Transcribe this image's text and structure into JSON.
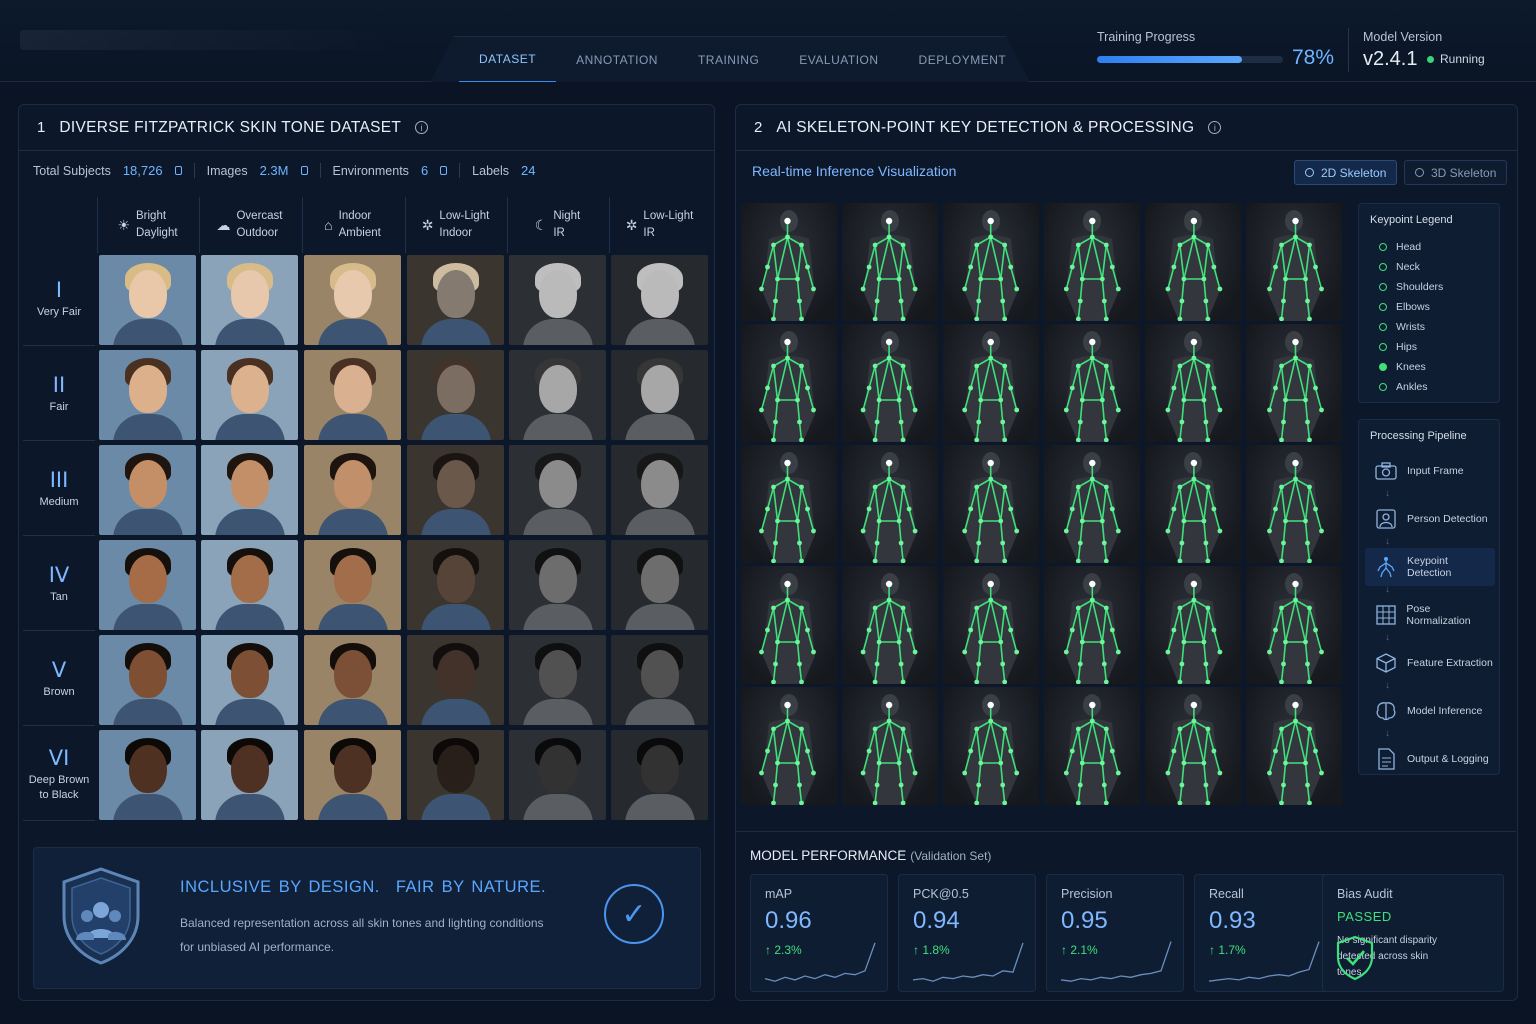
{
  "nav": {
    "tabs": [
      {
        "label": "DATASET",
        "active": true
      },
      {
        "label": "ANNOTATION",
        "active": false
      },
      {
        "label": "TRAINING",
        "active": false
      },
      {
        "label": "EVALUATION",
        "active": false
      },
      {
        "label": "DEPLOYMENT",
        "active": false
      }
    ]
  },
  "training": {
    "label": "Training Progress",
    "percent_text": "78%",
    "progress": 0.78
  },
  "model": {
    "label": "Model Version",
    "version": "v2.4.1",
    "status": "Running",
    "status_color": "#37d67a"
  },
  "dataset_panel": {
    "number": "1",
    "title": "DIVERSE FITZPATRICK SKIN TONE DATASET",
    "stats": [
      {
        "label": "Total Subjects",
        "value": "18,726"
      },
      {
        "label": "Images",
        "value": "2.3M"
      },
      {
        "label": "Environments",
        "value": "6"
      },
      {
        "label": "Labels",
        "value": "24"
      }
    ],
    "columns": [
      {
        "icon": "sun-icon",
        "glyph": "☀",
        "line1": "Bright",
        "line2": "Daylight"
      },
      {
        "icon": "cloud-icon",
        "glyph": "☁",
        "line1": "Overcast",
        "line2": "Outdoor"
      },
      {
        "icon": "house-icon",
        "glyph": "⌂",
        "line1": "Indoor",
        "line2": "Ambient"
      },
      {
        "icon": "lightbulb-icon",
        "glyph": "✲",
        "line1": "Low-Light",
        "line2": "Indoor"
      },
      {
        "icon": "moon-icon",
        "glyph": "☾",
        "line1": "Night",
        "line2": "IR"
      },
      {
        "icon": "ir-light-icon",
        "glyph": "✲",
        "line1": "Low-Light",
        "line2": "IR"
      }
    ],
    "rows": [
      {
        "roman": "I",
        "name": "Very Fair",
        "skin": "#e9c8aa",
        "hair": "#d9bb86"
      },
      {
        "roman": "II",
        "name": "Fair",
        "skin": "#ddb08c",
        "hair": "#4a3020"
      },
      {
        "roman": "III",
        "name": "Medium",
        "skin": "#c48e66",
        "hair": "#1f140e"
      },
      {
        "roman": "IV",
        "name": "Tan",
        "skin": "#a56c47",
        "hair": "#15100c"
      },
      {
        "roman": "V",
        "name": "Brown",
        "skin": "#7f4f33",
        "hair": "#140e0b"
      },
      {
        "roman": "VI",
        "name": "Deep Brown to Black",
        "skin": "#4f3122",
        "hair": "#0d0907"
      }
    ],
    "banner": {
      "title_a": "INCLUSIVE BY DESIGN.",
      "title_b": "FAIR BY NATURE.",
      "line1": "Balanced representation across all skin tones and lighting conditions",
      "line2": "for unbiased AI performance."
    }
  },
  "skeleton_panel": {
    "number": "2",
    "title": "AI SKELETON-POINT KEY DETECTION & PROCESSING",
    "subtitle": "Real-time Inference Visualization",
    "toggle_2d": "2D Skeleton",
    "toggle_3d": "3D Skeleton",
    "legend": {
      "title": "Keypoint Legend",
      "items": [
        "Head",
        "Neck",
        "Shoulders",
        "Elbows",
        "Wrists",
        "Hips",
        "Knees",
        "Ankles"
      ]
    },
    "pipeline": {
      "title": "Processing Pipeline",
      "steps": [
        {
          "label": "Input Frame",
          "icon": "camera-icon"
        },
        {
          "label": "Person Detection",
          "icon": "person-frame-icon"
        },
        {
          "label": "Keypoint Detection",
          "icon": "skeleton-icon"
        },
        {
          "label": "Pose Normalization",
          "icon": "grid-icon"
        },
        {
          "label": "Feature Extraction",
          "icon": "cube-icon"
        },
        {
          "label": "Model Inference",
          "icon": "brain-icon"
        },
        {
          "label": "Output & Logging",
          "icon": "document-icon"
        }
      ]
    },
    "performance": {
      "title": "MODEL PERFORMANCE",
      "subtitle": "(Validation Set)",
      "metrics": [
        {
          "label": "mAP",
          "value": "0.96",
          "delta": "↑ 2.3%"
        },
        {
          "label": "PCK@0.5",
          "value": "0.94",
          "delta": "↑ 1.8%"
        },
        {
          "label": "Precision",
          "value": "0.95",
          "delta": "↑ 2.1%"
        },
        {
          "label": "Recall",
          "value": "0.93",
          "delta": "↑ 1.7%"
        }
      ],
      "bias": {
        "label": "Bias Audit",
        "status": "PASSED",
        "note": "No significant disparity detected across skin tones."
      }
    }
  },
  "colors": {
    "accent": "#3c8cf0",
    "keypoint": "#3ee07a",
    "value": "#7fb8ff"
  }
}
